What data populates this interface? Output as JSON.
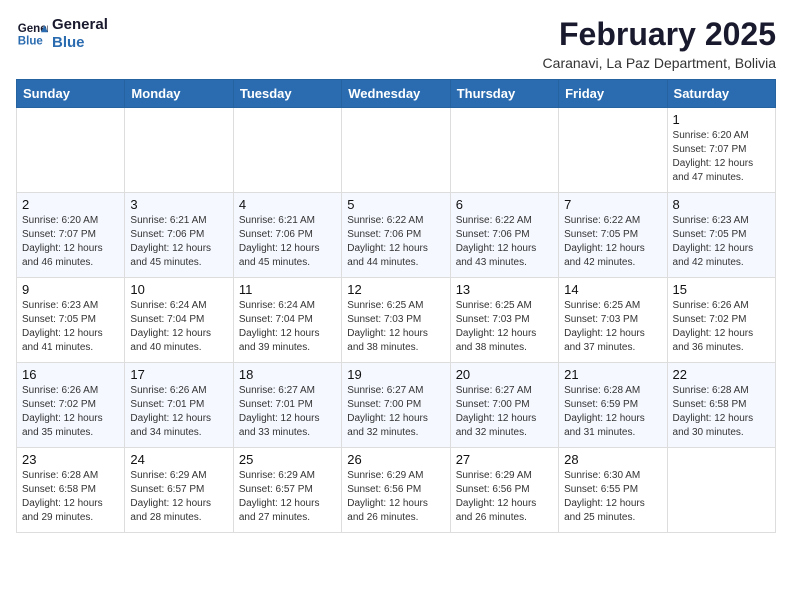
{
  "header": {
    "logo_line1": "General",
    "logo_line2": "Blue",
    "month_year": "February 2025",
    "location": "Caranavi, La Paz Department, Bolivia"
  },
  "days_of_week": [
    "Sunday",
    "Monday",
    "Tuesday",
    "Wednesday",
    "Thursday",
    "Friday",
    "Saturday"
  ],
  "weeks": [
    [
      {
        "day": "",
        "info": ""
      },
      {
        "day": "",
        "info": ""
      },
      {
        "day": "",
        "info": ""
      },
      {
        "day": "",
        "info": ""
      },
      {
        "day": "",
        "info": ""
      },
      {
        "day": "",
        "info": ""
      },
      {
        "day": "1",
        "info": "Sunrise: 6:20 AM\nSunset: 7:07 PM\nDaylight: 12 hours\nand 47 minutes."
      }
    ],
    [
      {
        "day": "2",
        "info": "Sunrise: 6:20 AM\nSunset: 7:07 PM\nDaylight: 12 hours\nand 46 minutes."
      },
      {
        "day": "3",
        "info": "Sunrise: 6:21 AM\nSunset: 7:06 PM\nDaylight: 12 hours\nand 45 minutes."
      },
      {
        "day": "4",
        "info": "Sunrise: 6:21 AM\nSunset: 7:06 PM\nDaylight: 12 hours\nand 45 minutes."
      },
      {
        "day": "5",
        "info": "Sunrise: 6:22 AM\nSunset: 7:06 PM\nDaylight: 12 hours\nand 44 minutes."
      },
      {
        "day": "6",
        "info": "Sunrise: 6:22 AM\nSunset: 7:06 PM\nDaylight: 12 hours\nand 43 minutes."
      },
      {
        "day": "7",
        "info": "Sunrise: 6:22 AM\nSunset: 7:05 PM\nDaylight: 12 hours\nand 42 minutes."
      },
      {
        "day": "8",
        "info": "Sunrise: 6:23 AM\nSunset: 7:05 PM\nDaylight: 12 hours\nand 42 minutes."
      }
    ],
    [
      {
        "day": "9",
        "info": "Sunrise: 6:23 AM\nSunset: 7:05 PM\nDaylight: 12 hours\nand 41 minutes."
      },
      {
        "day": "10",
        "info": "Sunrise: 6:24 AM\nSunset: 7:04 PM\nDaylight: 12 hours\nand 40 minutes."
      },
      {
        "day": "11",
        "info": "Sunrise: 6:24 AM\nSunset: 7:04 PM\nDaylight: 12 hours\nand 39 minutes."
      },
      {
        "day": "12",
        "info": "Sunrise: 6:25 AM\nSunset: 7:03 PM\nDaylight: 12 hours\nand 38 minutes."
      },
      {
        "day": "13",
        "info": "Sunrise: 6:25 AM\nSunset: 7:03 PM\nDaylight: 12 hours\nand 38 minutes."
      },
      {
        "day": "14",
        "info": "Sunrise: 6:25 AM\nSunset: 7:03 PM\nDaylight: 12 hours\nand 37 minutes."
      },
      {
        "day": "15",
        "info": "Sunrise: 6:26 AM\nSunset: 7:02 PM\nDaylight: 12 hours\nand 36 minutes."
      }
    ],
    [
      {
        "day": "16",
        "info": "Sunrise: 6:26 AM\nSunset: 7:02 PM\nDaylight: 12 hours\nand 35 minutes."
      },
      {
        "day": "17",
        "info": "Sunrise: 6:26 AM\nSunset: 7:01 PM\nDaylight: 12 hours\nand 34 minutes."
      },
      {
        "day": "18",
        "info": "Sunrise: 6:27 AM\nSunset: 7:01 PM\nDaylight: 12 hours\nand 33 minutes."
      },
      {
        "day": "19",
        "info": "Sunrise: 6:27 AM\nSunset: 7:00 PM\nDaylight: 12 hours\nand 32 minutes."
      },
      {
        "day": "20",
        "info": "Sunrise: 6:27 AM\nSunset: 7:00 PM\nDaylight: 12 hours\nand 32 minutes."
      },
      {
        "day": "21",
        "info": "Sunrise: 6:28 AM\nSunset: 6:59 PM\nDaylight: 12 hours\nand 31 minutes."
      },
      {
        "day": "22",
        "info": "Sunrise: 6:28 AM\nSunset: 6:58 PM\nDaylight: 12 hours\nand 30 minutes."
      }
    ],
    [
      {
        "day": "23",
        "info": "Sunrise: 6:28 AM\nSunset: 6:58 PM\nDaylight: 12 hours\nand 29 minutes."
      },
      {
        "day": "24",
        "info": "Sunrise: 6:29 AM\nSunset: 6:57 PM\nDaylight: 12 hours\nand 28 minutes."
      },
      {
        "day": "25",
        "info": "Sunrise: 6:29 AM\nSunset: 6:57 PM\nDaylight: 12 hours\nand 27 minutes."
      },
      {
        "day": "26",
        "info": "Sunrise: 6:29 AM\nSunset: 6:56 PM\nDaylight: 12 hours\nand 26 minutes."
      },
      {
        "day": "27",
        "info": "Sunrise: 6:29 AM\nSunset: 6:56 PM\nDaylight: 12 hours\nand 26 minutes."
      },
      {
        "day": "28",
        "info": "Sunrise: 6:30 AM\nSunset: 6:55 PM\nDaylight: 12 hours\nand 25 minutes."
      },
      {
        "day": "",
        "info": ""
      }
    ]
  ]
}
